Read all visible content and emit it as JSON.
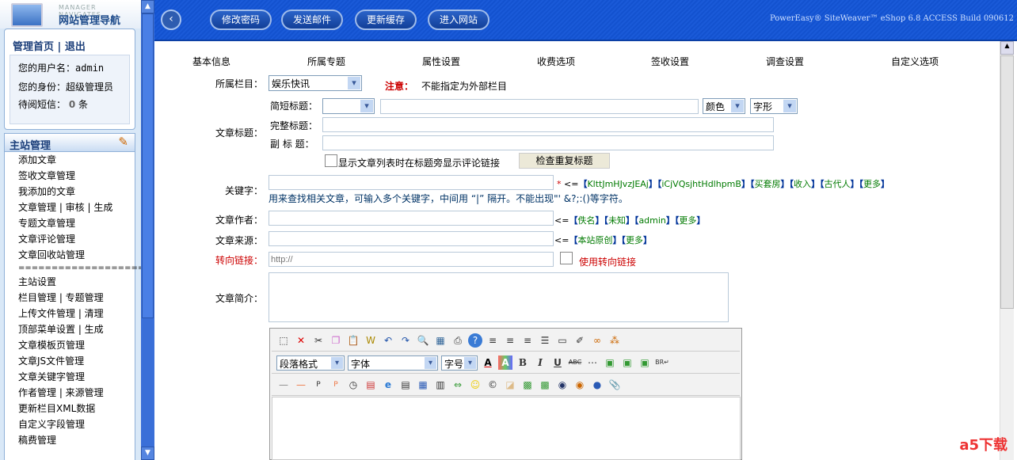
{
  "sidebar": {
    "logo_en": "MANAGER NAVIGATES",
    "logo_cn": "网站管理导航",
    "home": "管理首页",
    "sep": "|",
    "logout": "退出",
    "username_label": "您的用户名：",
    "username": "admin",
    "role_label": "您的身份：",
    "role": "超级管理员",
    "msg_label": "待阅短信：",
    "msg_count": "0",
    "msg_unit": "条",
    "section": "主站管理",
    "items": [
      "添加文章",
      "签收文章管理",
      "我添加的文章",
      "文章管理 | 审核 | 生成",
      "专题文章管理",
      "文章评论管理",
      "文章回收站管理",
      "====================",
      "主站设置",
      "栏目管理 | 专题管理",
      "上传文件管理 | 清理",
      "顶部菜单设置 | 生成",
      "文章模板页管理",
      "文章JS文件管理",
      "文章关键字管理",
      "作者管理 | 来源管理",
      "更新栏目XML数据",
      "自定义字段管理",
      "稿费管理"
    ]
  },
  "header": {
    "buttons": [
      "修改密码",
      "发送邮件",
      "更新缓存",
      "进入网站"
    ],
    "version": "PowerEasy® SiteWeaver™ eShop 6.8 ACCESS Build 090612"
  },
  "tabs": [
    "基本信息",
    "所属专题",
    "属性设置",
    "收费选项",
    "签收设置",
    "调查设置",
    "自定义选项"
  ],
  "form": {
    "column_label": "所属栏目：",
    "column_value": "娱乐快讯",
    "notice_label": "注意：",
    "notice_text": "不能指定为外部栏目",
    "title_label": "文章标题：",
    "short_title_label": "简短标题：",
    "color_label": "颜色",
    "font_label": "字形",
    "full_title_label": "完整标题：",
    "subtitle_label": "副 标 题：",
    "show_comment_label": "显示文章列表时在标题旁显示评论链接",
    "check_dup_button": "检查重复标题",
    "keyword_label": "关键字：",
    "required": "*",
    "arrow": "<=",
    "keyword_suggestions": [
      "KlttJmHJvzJEAj",
      "iCjVQsjhtHdlhpmB",
      "买套房",
      "收入",
      "古代人",
      "更多"
    ],
    "keyword_hint": "用来查找相关文章，可输入多个关键字，中间用 “|” 隔开。不能出现\"' &?;:()等字符。",
    "author_label": "文章作者：",
    "author_suggestions": [
      "佚名",
      "未知",
      "admin",
      "更多"
    ],
    "source_label": "文章来源：",
    "source_suggestions": [
      "本站原创",
      "更多"
    ],
    "redirect_label": "转向链接：",
    "redirect_placeholder": "http://",
    "use_redirect_label": "使用转向链接",
    "intro_label": "文章简介："
  },
  "editor": {
    "paragraph": "段落格式",
    "font": "字体",
    "size": "字号"
  },
  "watermark": "a5下载"
}
